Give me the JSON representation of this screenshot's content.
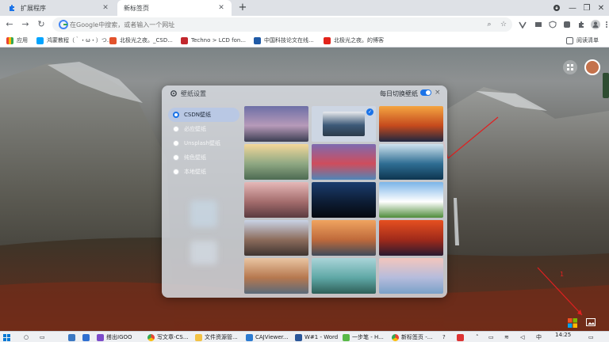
{
  "browser": {
    "tabs": [
      {
        "title": "扩展程序",
        "icon": "puzzle-icon",
        "active": false
      },
      {
        "title": "新标签页",
        "icon": "none",
        "active": true
      }
    ],
    "new_tab": "+",
    "omnibox_placeholder": "在Google中搜索，或者输入一个网址"
  },
  "bookmarks": [
    {
      "label": "应用",
      "color": "#4285f4"
    },
    {
      "label": "鸿蒙教程（｀・ω・）つ...",
      "color": "#00a4ff"
    },
    {
      "label": "北极光之夜。_CSD...",
      "color": "#e2522c"
    },
    {
      "label": "Techno > LCD fon...",
      "color": "#c2272d"
    },
    {
      "label": "中国科技论文在线...",
      "color": "#1f5aa6"
    },
    {
      "label": "北极光之夜。的博客",
      "color": "#e2231a"
    },
    {
      "label": "阅读清单",
      "color": "#5f6368"
    }
  ],
  "dialog": {
    "title": "壁纸设置",
    "daily_switch_label": "每日切换壁纸",
    "daily_switch_on": true,
    "close": "×",
    "sources": [
      {
        "label": "CSDN壁纸",
        "selected": true
      },
      {
        "label": "必应壁纸",
        "selected": false
      },
      {
        "label": "Unsplash壁纸",
        "selected": false
      },
      {
        "label": "纯色壁纸",
        "selected": false
      },
      {
        "label": "本地壁纸",
        "selected": false
      }
    ],
    "wallpapers": [
      {
        "name": "purple-mountain-lake",
        "colors": [
          "#6d6fa6",
          "#b79ab9",
          "#3b3e52"
        ],
        "selected": false
      },
      {
        "name": "yosemite-valley",
        "colors": [
          "#e9ebee",
          "#3d5a78",
          "#2c3b4a"
        ],
        "selected": true
      },
      {
        "name": "orange-sunset",
        "colors": [
          "#f4a541",
          "#c54a1d",
          "#1f2740"
        ],
        "selected": false
      },
      {
        "name": "misty-hills",
        "colors": [
          "#f3d79a",
          "#8fa883",
          "#4d6a52"
        ],
        "selected": false
      },
      {
        "name": "burano-houses",
        "colors": [
          "#7d6bb0",
          "#cf4d5c",
          "#4f86b8"
        ],
        "selected": false
      },
      {
        "name": "ocean-wave",
        "colors": [
          "#cfe3ee",
          "#2f6e93",
          "#0d3550"
        ],
        "selected": false
      },
      {
        "name": "pink-desert-sky",
        "colors": [
          "#e5b8b8",
          "#a46d6d",
          "#5a3a3f"
        ],
        "selected": false
      },
      {
        "name": "dark-horizon",
        "colors": [
          "#1b3d6e",
          "#0d1d35",
          "#05080f"
        ],
        "selected": false
      },
      {
        "name": "green-field-sky",
        "colors": [
          "#7bb5e8",
          "#ffffff",
          "#4f8c3a"
        ],
        "selected": false
      },
      {
        "name": "rocky-peaks",
        "colors": [
          "#c9d3e6",
          "#8c6c5c",
          "#3f3430"
        ],
        "selected": false
      },
      {
        "name": "winding-road",
        "colors": [
          "#f0a460",
          "#bf6a3b",
          "#3f4b5a"
        ],
        "selected": false
      },
      {
        "name": "red-canyon",
        "colors": [
          "#e65020",
          "#a02a1a",
          "#2a1a30"
        ],
        "selected": false
      },
      {
        "name": "canyon-sunrise",
        "colors": [
          "#e9c5a2",
          "#b6784f",
          "#5b6a7a"
        ],
        "selected": false
      },
      {
        "name": "turquoise-valley",
        "colors": [
          "#a9d4d8",
          "#5fa8a6",
          "#2e5f58"
        ],
        "selected": false
      },
      {
        "name": "pastel-sunset",
        "colors": [
          "#f3c6bd",
          "#b5bcdc",
          "#7aa0c8"
        ],
        "selected": false
      }
    ]
  },
  "annotations": {
    "number_label": "1",
    "arrow_color": "#e02020"
  },
  "taskbar": {
    "items": [
      {
        "label": "",
        "icon": "windows-icon"
      },
      {
        "label": "",
        "icon": "search-icon"
      },
      {
        "label": "",
        "icon": "task-view-icon"
      },
      {
        "label": "",
        "icon": "file-icon"
      },
      {
        "label": "",
        "icon": "outlook-icon"
      },
      {
        "label": "",
        "icon": "store-icon"
      },
      {
        "label": "搭出IGOO",
        "icon": "app-icon"
      },
      {
        "label": "写文章-CS...",
        "icon": "chrome-icon"
      },
      {
        "label": "文件资源管...",
        "icon": "folder-icon"
      },
      {
        "label": "CAJViewer...",
        "icon": "caj-icon"
      },
      {
        "label": "W#1 - Word",
        "icon": "word-icon"
      },
      {
        "label": "一步笔 - H...",
        "icon": "note-icon"
      },
      {
        "label": "新标签页 -...",
        "icon": "chrome-icon"
      }
    ],
    "time": "14:25"
  }
}
